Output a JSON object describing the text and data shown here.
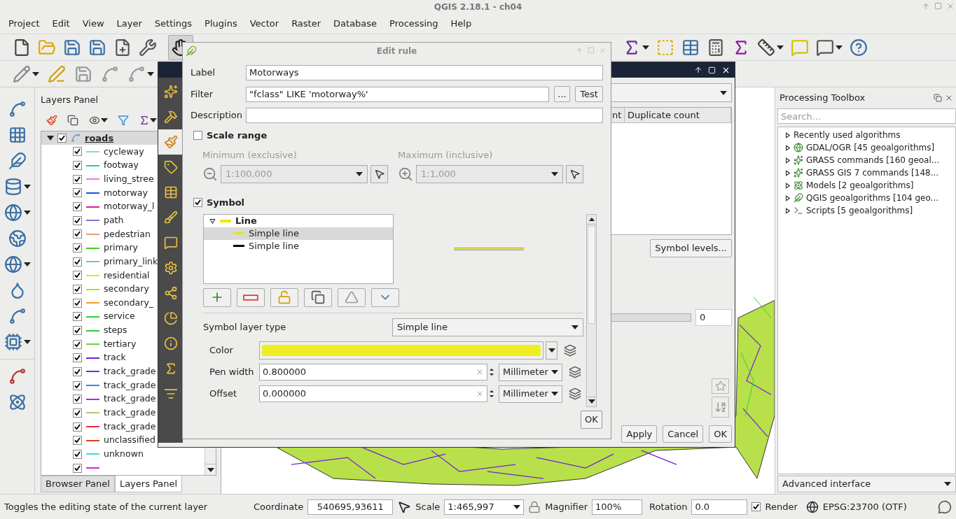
{
  "window": {
    "title": "QGIS 2.18.1 - ch04"
  },
  "menu": [
    "Project",
    "Edit",
    "View",
    "Layer",
    "Settings",
    "Plugins",
    "Vector",
    "Raster",
    "Database",
    "Processing",
    "Help"
  ],
  "layers_panel": {
    "title": "Layers Panel",
    "root": {
      "name": "roads",
      "checked": true,
      "expanded": true,
      "children": [
        {
          "name": "cycleway",
          "checked": true,
          "color": "#88e0b0"
        },
        {
          "name": "footway",
          "checked": true,
          "color": "#20d0a0"
        },
        {
          "name": "living_stree",
          "checked": true,
          "color": "#e080e0"
        },
        {
          "name": "motorway",
          "checked": true,
          "color": "#2050e0"
        },
        {
          "name": "motorway_l",
          "checked": true,
          "color": "#e02090"
        },
        {
          "name": "path",
          "checked": true,
          "color": "#8070e0"
        },
        {
          "name": "pedestrian",
          "checked": true,
          "color": "#e0a080"
        },
        {
          "name": "primary",
          "checked": true,
          "color": "#40d020"
        },
        {
          "name": "primary_link",
          "checked": true,
          "color": "#70c0d0"
        },
        {
          "name": "residential",
          "checked": true,
          "color": "#f0e020"
        },
        {
          "name": "secondary",
          "checked": true,
          "color": "#a0e040"
        },
        {
          "name": "secondary_",
          "checked": true,
          "color": "#f0a020"
        },
        {
          "name": "service",
          "checked": true,
          "color": "#30d030"
        },
        {
          "name": "steps",
          "checked": true,
          "color": "#30c840"
        },
        {
          "name": "tertiary",
          "checked": true,
          "color": "#70d040"
        },
        {
          "name": "track",
          "checked": true,
          "color": "#7020e0"
        },
        {
          "name": "track_grade",
          "checked": true,
          "color": "#3050e0"
        },
        {
          "name": "track_grade",
          "checked": true,
          "color": "#2090e0"
        },
        {
          "name": "track_grade",
          "checked": true,
          "color": "#a030e0"
        },
        {
          "name": "track_grade",
          "checked": true,
          "color": "#c0c070"
        },
        {
          "name": "track_grade",
          "checked": true,
          "color": "#e03040"
        },
        {
          "name": "unclassified",
          "checked": true,
          "color": "#e04020"
        },
        {
          "name": "unknown",
          "checked": true,
          "color": "#30e0e0"
        },
        {
          "checked": true,
          "color": "#e020e0"
        }
      ]
    },
    "tabs": [
      {
        "label": "Browser Panel",
        "selected": false
      },
      {
        "label": "Layers Panel",
        "selected": true
      }
    ]
  },
  "processing_toolbox": {
    "title": "Processing Toolbox",
    "search": {
      "placeholder": "Search..."
    },
    "items": [
      {
        "label": "Recently used algorithms",
        "expanded": false
      },
      {
        "label": "GDAL/OGR [45 geoalgorithms]",
        "expanded": false
      },
      {
        "label": "GRASS commands [160 geoal...",
        "expanded": false
      },
      {
        "label": "GRASS GIS 7 commands [148...",
        "expanded": false
      },
      {
        "label": "Models [2 geoalgorithms]",
        "expanded": false
      },
      {
        "label": "QGIS geoalgorithms [104 geo...",
        "expanded": false
      },
      {
        "label": "Scripts [5 geoalgorithms]",
        "expanded": false
      }
    ],
    "mode": "Advanced interface"
  },
  "layer_properties": {
    "sidebar_tabs": [
      {
        "selected": false
      },
      {
        "selected": false
      },
      {
        "selected": true
      },
      {
        "selected": false
      },
      {
        "selected": false
      },
      {
        "selected": false
      },
      {
        "selected": false
      },
      {
        "selected": false
      },
      {
        "selected": false
      },
      {
        "selected": false
      },
      {
        "selected": false
      },
      {
        "selected": false
      },
      {
        "selected": false
      }
    ],
    "columns": [
      "nt",
      "Duplicate count"
    ],
    "symbol_levels_button": "Symbol levels...",
    "spin_value": "0",
    "buttons": [
      "Apply",
      "Cancel",
      "OK"
    ]
  },
  "edit_rule": {
    "title": "Edit rule",
    "label": {
      "label": "Label",
      "value": "Motorways"
    },
    "filter": {
      "label": "Filter",
      "value": "\"fclass\" LIKE 'motorway%'",
      "expression_button": "...",
      "test_button": "Test"
    },
    "description": {
      "label": "Description"
    },
    "scale_range": {
      "label": "Scale range",
      "checked": false,
      "minimum": {
        "label": "Minimum (exclusive)",
        "value": "1:100,000"
      },
      "maximum": {
        "label": "Maximum (inclusive)",
        "value": "1:1,000"
      }
    },
    "symbol": {
      "label": "Symbol",
      "checked": true,
      "tree": {
        "label": "Line",
        "expanded": true,
        "color": "#e8e800",
        "children": [
          {
            "label": "Simple line",
            "selected": true,
            "color": "#e8e800"
          },
          {
            "label": "Simple line",
            "selected": false,
            "color": "#000000"
          }
        ]
      },
      "layer_type": {
        "label": "Symbol layer type",
        "value": "Simple line"
      },
      "properties": [
        {
          "kind": "color",
          "label": "Color",
          "color": "#eeee22"
        },
        {
          "kind": "number",
          "label": "Pen width",
          "value": "0.800000",
          "unit": "Millimeter"
        },
        {
          "kind": "number",
          "label": "Offset",
          "value": "0.000000",
          "unit": "Millimeter"
        }
      ]
    },
    "ok_button": "OK"
  },
  "status_bar": {
    "message": "Toggles the editing state of the current layer",
    "coordinate": {
      "label": "Coordinate",
      "value": "540695,93611"
    },
    "scale": {
      "label": "Scale",
      "value": "1:465,997"
    },
    "magnifier": {
      "label": "Magnifier",
      "value": "100%"
    },
    "rotation": {
      "label": "Rotation",
      "value": "0.0"
    },
    "render": {
      "label": "Render",
      "checked": true
    },
    "crs": "EPSG:23700 (OTF)"
  }
}
